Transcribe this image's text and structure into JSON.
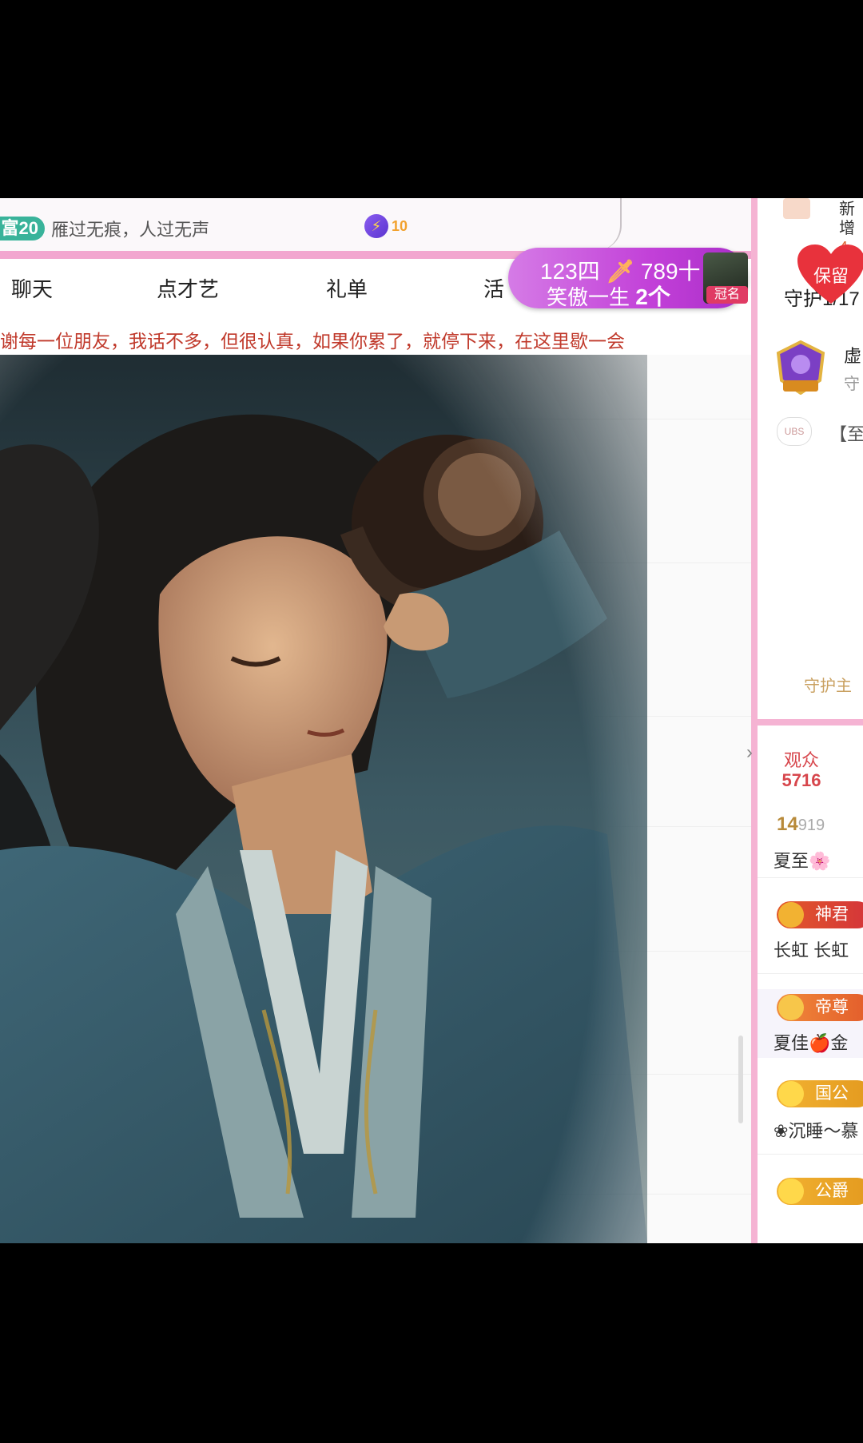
{
  "topbar": {
    "level_badge": "富20",
    "slogan": "雁过无痕，人过无声",
    "energy_count": "10"
  },
  "tabs": [
    "聊天",
    "点才艺",
    "礼单",
    "活"
  ],
  "notice": "谢每一位朋友，我话不多，但很认真，如果你累了，就停下来，在这里歇一会",
  "banner": {
    "line1_left": "123四",
    "line1_right": "789十",
    "line2_name": "笑傲一生",
    "line2_count": "2个",
    "tag": "冠名"
  },
  "right_panel": {
    "new_label": "新增",
    "new_count": "4人",
    "guard_tab": "守护1/17",
    "keep_button": "保留",
    "guard_name": "虚",
    "guard_sub": "守",
    "guard_badge": "守护之星",
    "rank_icon": "UBS",
    "rank_text": "【至",
    "guard_main": "守护主",
    "audience_label": "观众",
    "audience_count": "5716",
    "users": [
      {
        "level": "14",
        "id": "919",
        "name": "夏至🌸"
      },
      {
        "badge": "神君",
        "name": "长虹 长虹"
      },
      {
        "badge": "帝尊",
        "name": "夏佳🍎金"
      },
      {
        "badge": "国公",
        "name": "❀沉睡～慕"
      },
      {
        "badge": "公爵",
        "name": ""
      }
    ]
  },
  "colors": {
    "accent_pink": "#f2a6cf",
    "banner_purple": "#c240d8",
    "notice_red": "#c0392b",
    "level_green": "#39b39a"
  }
}
